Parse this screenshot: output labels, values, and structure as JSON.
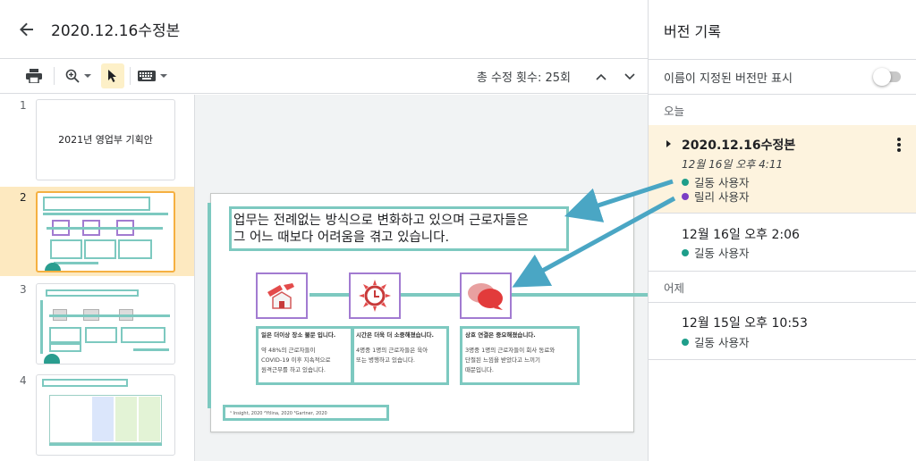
{
  "header": {
    "back_icon": "arrow-left-icon",
    "title": "2020.12.16수정본"
  },
  "toolbar": {
    "edit_count": "총 수정 횟수: 25회",
    "icons": [
      "print-icon",
      "zoom-icon",
      "select-cursor-icon",
      "keyboard-icon",
      "chevron-up-icon",
      "chevron-down-icon"
    ]
  },
  "filmstrip": {
    "slides": [
      {
        "num": "1",
        "title": "2021년 영업부 기획안"
      },
      {
        "num": "2",
        "selected": true
      },
      {
        "num": "3"
      },
      {
        "num": "4"
      }
    ]
  },
  "slide": {
    "title_line1": "업무는 전례없는 방식으로 변화하고 있으며 근로자들은",
    "title_line2": "그 어느 때보다 어려움을 겪고 있습니다.",
    "cards": [
      {
        "heading": "일은 더이상 장소 불문 입니다.",
        "line1": "약 48%의 근로자들이",
        "line2": "COVID-19 이후 지속적으로",
        "line3": "원격근무를 하고 있습니다."
      },
      {
        "heading": "시간은 더욱 더 소중해졌습니다.",
        "line1": "4명중 1명의 근로자들은 육아",
        "line2": "또는 병행하고 있습니다.",
        "line3": ""
      },
      {
        "heading": "상호 연결은 중요해졌습니다.",
        "line1": "3명중 1명의 근로자들이 회사 동료와",
        "line2": "단절된 느낌을 받았다고 느끼기",
        "line3": "때문입니다."
      }
    ],
    "footnote": "¹ Insight, 2020 ²Ytlina, 2020 ³Gartner, 2020"
  },
  "panel": {
    "title": "버전 기록",
    "named_only_label": "이름이 지정된 버전만 표시",
    "named_only_enabled": false,
    "sections": [
      {
        "label": "오늘",
        "versions": [
          {
            "name": "2020.12.16수정본",
            "time": "12월 16일 오후 4:11",
            "users": [
              {
                "name": "길동 사용자",
                "color": "#1e9e8a"
              },
              {
                "name": "릴리 사용자",
                "color": "#7b3fc4"
              }
            ],
            "selected": true
          },
          {
            "name": "12월 16일 오후 2:06",
            "users": [
              {
                "name": "길동 사용자",
                "color": "#1e9e8a"
              }
            ]
          }
        ]
      },
      {
        "label": "어제",
        "versions": [
          {
            "name": "12월 15일 오후 10:53",
            "users": [
              {
                "name": "길동 사용자",
                "color": "#1e9e8a"
              }
            ]
          }
        ]
      }
    ]
  },
  "colors": {
    "highlight_teal": "#7dc9c0",
    "highlight_purple": "#a27bd1",
    "arrow": "#4aa6c4",
    "selected_version_bg": "#fdf3de",
    "selected_slide_bg": "#fde9c0"
  }
}
